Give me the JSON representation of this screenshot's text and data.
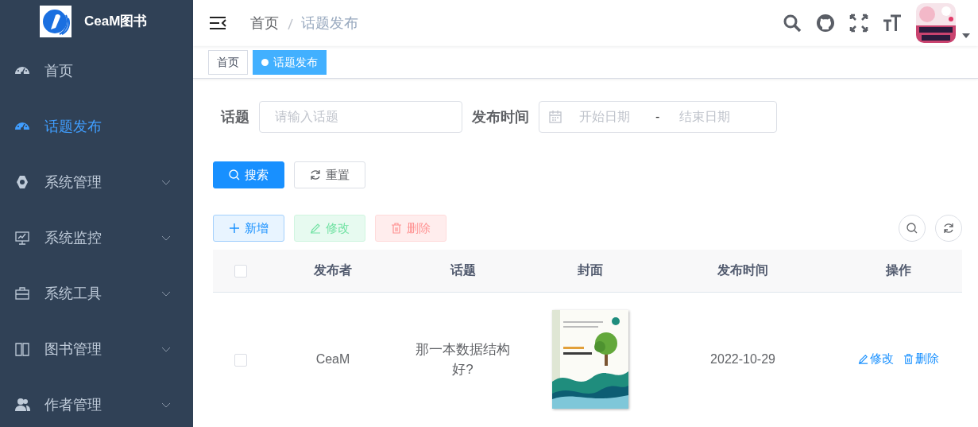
{
  "sidebar": {
    "logo_text": "CeaM图书",
    "items": [
      {
        "label": "首页",
        "selected": false,
        "expandable": false
      },
      {
        "label": "话题发布",
        "selected": true,
        "expandable": false
      },
      {
        "label": "系统管理",
        "selected": false,
        "expandable": true
      },
      {
        "label": "系统监控",
        "selected": false,
        "expandable": true
      },
      {
        "label": "系统工具",
        "selected": false,
        "expandable": true
      },
      {
        "label": "图书管理",
        "selected": false,
        "expandable": true
      },
      {
        "label": "作者管理",
        "selected": false,
        "expandable": true
      }
    ]
  },
  "breadcrumb": [
    "首页",
    "话题发布"
  ],
  "tags": [
    {
      "label": "首页",
      "selected": false
    },
    {
      "label": "话题发布",
      "selected": true
    }
  ],
  "search_form": {
    "topic_label": "话题",
    "topic_placeholder": "请输入话题",
    "date_label": "发布时间",
    "start_placeholder": "开始日期",
    "separator": "-",
    "end_placeholder": "结束日期"
  },
  "form_buttons": [
    {
      "label": "搜索",
      "kind": "primary"
    },
    {
      "label": "重置",
      "kind": "default"
    }
  ],
  "toolbar_buttons": [
    {
      "label": "新增",
      "kind": "add"
    },
    {
      "label": "修改",
      "kind": "edit"
    },
    {
      "label": "删除",
      "kind": "delete"
    }
  ],
  "table": {
    "select_all_checked": false,
    "columns": [
      "发布者",
      "话题",
      "封面",
      "发布时间",
      "操作"
    ],
    "rows": [
      {
        "checked": false,
        "publisher": "CeaM",
        "topic": "那一本数据结构好?",
        "cover": {
          "kind": "picture"
        },
        "date": "2022-10-29",
        "actions": [
          "修改",
          "删除"
        ]
      }
    ]
  }
}
